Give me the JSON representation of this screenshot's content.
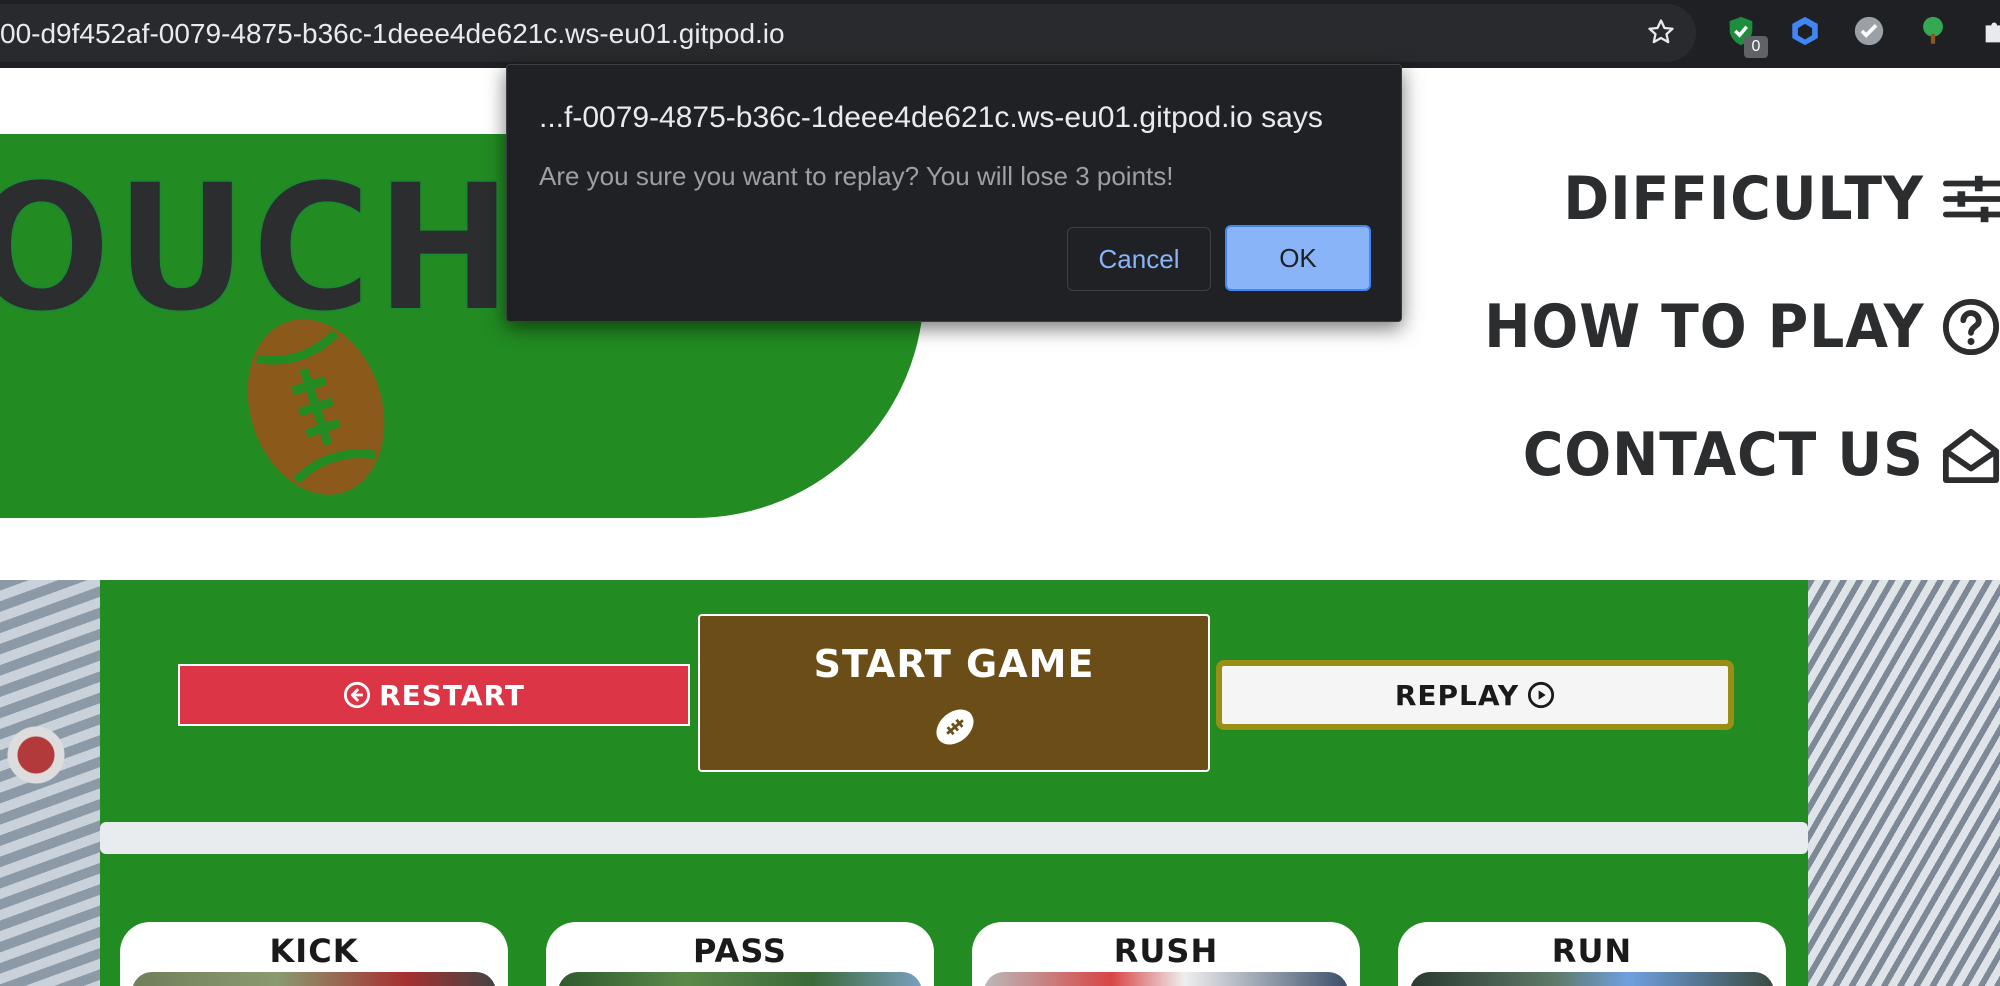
{
  "browser": {
    "url": "00-d9f452af-0079-4875-b36c-1deee4de621c.ws-eu01.gitpod.io",
    "extensions": [
      {
        "name": "shield-check-extension",
        "badge": "0",
        "color": "#1e8e3e"
      },
      {
        "name": "blue-cube-extension",
        "color": "#4285f4"
      },
      {
        "name": "gray-check-extension",
        "color": "#9aa0a6"
      },
      {
        "name": "tree-extension",
        "color": "#34a853"
      },
      {
        "name": "puzzle-extension",
        "color": "#e8eaed"
      }
    ]
  },
  "hero": {
    "title": "OUCHDO",
    "icon": "football-icon",
    "bg_color": "#228b22"
  },
  "nav": {
    "items": [
      {
        "label": "DIFFICULTY",
        "icon": "sliders-icon"
      },
      {
        "label": "HOW TO PLAY",
        "icon": "question-circle-icon"
      },
      {
        "label": "CONTACT US",
        "icon": "envelope-open-icon"
      }
    ]
  },
  "game": {
    "restart_label": "RESTART",
    "restart_icon": "arrow-left-circle-icon",
    "start_label": "START GAME",
    "start_icon": "football-icon",
    "replay_label": "REPLAY",
    "replay_icon": "play-circle-icon",
    "progress": 0,
    "cards": [
      {
        "label": "KICK"
      },
      {
        "label": "PASS"
      },
      {
        "label": "RUSH"
      },
      {
        "label": "RUN"
      }
    ]
  },
  "dialog": {
    "title": "...f-0079-4875-b36c-1deee4de621c.ws-eu01.gitpod.io says",
    "message": "Are you sure you want to replay? You will lose 3 points!",
    "cancel_label": "Cancel",
    "ok_label": "OK"
  },
  "colors": {
    "green": "#228b22",
    "red": "#dc3545",
    "brown": "#6b4e17",
    "olive": "#9a8f15"
  }
}
